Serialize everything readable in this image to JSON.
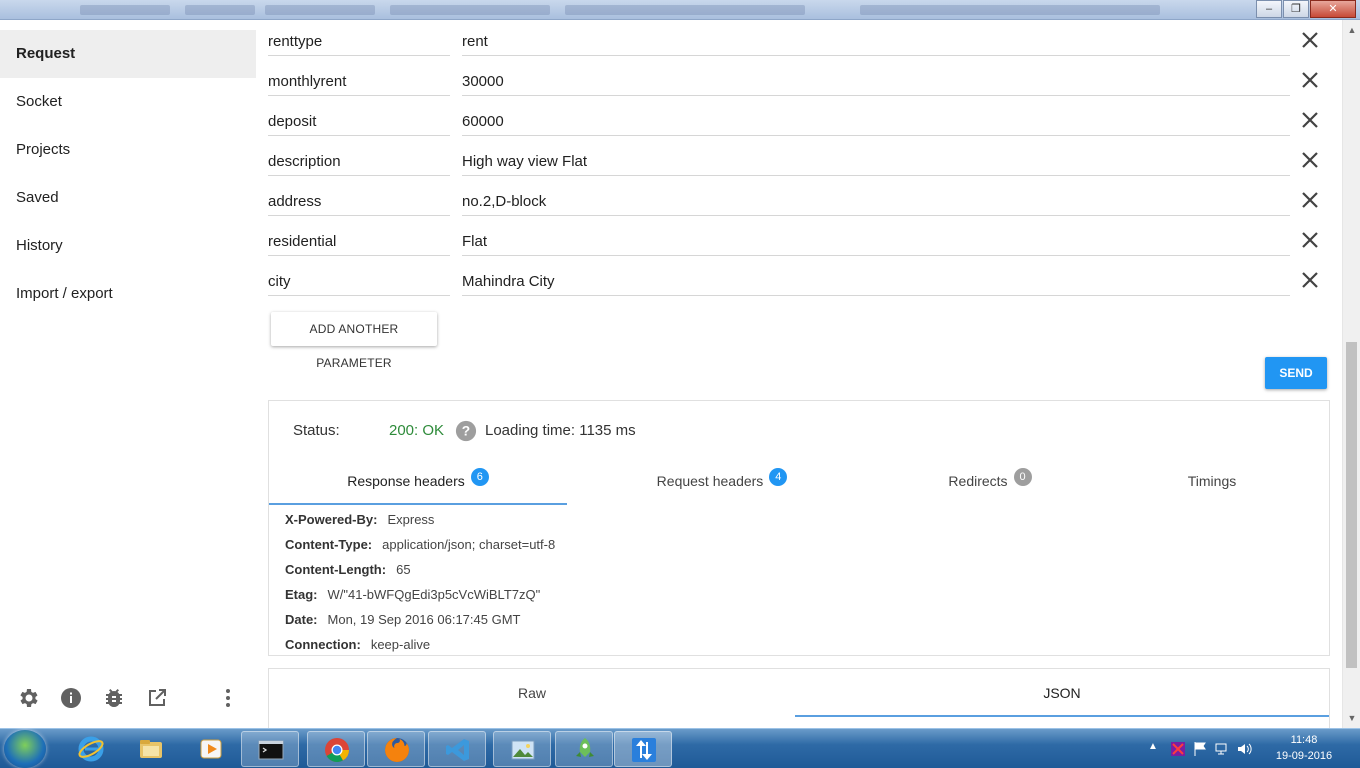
{
  "nav": {
    "items": [
      {
        "label": "Request"
      },
      {
        "label": "Socket"
      },
      {
        "label": "Projects"
      },
      {
        "label": "Saved"
      },
      {
        "label": "History"
      },
      {
        "label": "Import / export"
      }
    ]
  },
  "params": [
    {
      "name": "renttype",
      "value": "rent"
    },
    {
      "name": "monthlyrent",
      "value": "30000"
    },
    {
      "name": "deposit",
      "value": "60000"
    },
    {
      "name": "description",
      "value": "High way view Flat"
    },
    {
      "name": "address",
      "value": "no.2,D-block"
    },
    {
      "name": "residential",
      "value": "Flat"
    },
    {
      "name": "city",
      "value": "Mahindra City"
    }
  ],
  "actions": {
    "add_param": "ADD ANOTHER PARAMETER",
    "send": "SEND"
  },
  "response": {
    "status_label": "Status:",
    "status_value": "200: OK",
    "loading_time": "Loading time: 1135 ms",
    "tabs": [
      {
        "label": "Response headers",
        "badge": "6"
      },
      {
        "label": "Request headers",
        "badge": "4"
      },
      {
        "label": "Redirects",
        "badge": "0"
      },
      {
        "label": "Timings",
        "badge": ""
      }
    ],
    "headers": [
      {
        "name": "X-Powered-By:",
        "value": "Express"
      },
      {
        "name": "Content-Type:",
        "value": "application/json; charset=utf-8"
      },
      {
        "name": "Content-Length:",
        "value": "65"
      },
      {
        "name": "Etag:",
        "value": "W/\"41-bWFQgEdi3p5cVcWiBLT7zQ\""
      },
      {
        "name": "Date:",
        "value": "Mon, 19 Sep 2016 06:17:45 GMT"
      },
      {
        "name": "Connection:",
        "value": "keep-alive"
      }
    ],
    "body_tabs": [
      {
        "label": "Raw"
      },
      {
        "label": "JSON"
      }
    ]
  },
  "taskbar": {
    "time": "11:48",
    "date": "19-09-2016"
  },
  "colors": {
    "accent": "#2196f3",
    "status_ok": "#2e8b3a",
    "badge_zero": "#9e9e9e"
  }
}
